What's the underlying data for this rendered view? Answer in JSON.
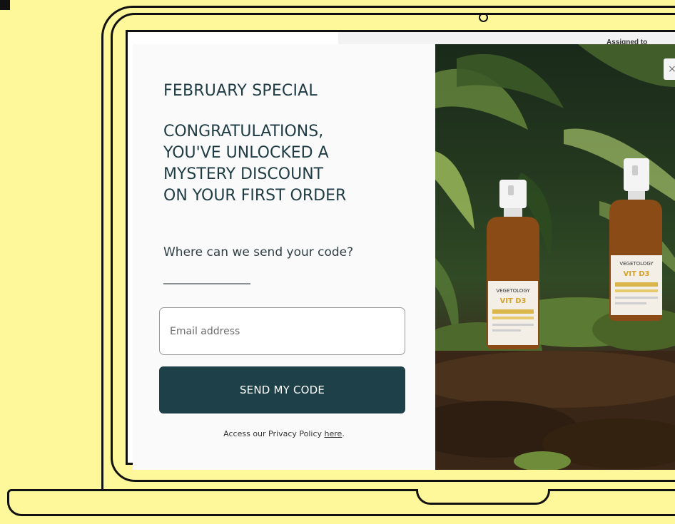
{
  "background_page": {
    "assigned_text": "Assigned to"
  },
  "popup": {
    "eyebrow": "FEBRUARY SPECIAL",
    "headline_lines": [
      "CONGRATULATIONS,",
      "YOU'VE UNLOCKED A",
      "MYSTERY DISCOUNT",
      "ON YOUR FIRST ORDER"
    ],
    "subhead": "Where can we send your code?",
    "email_placeholder": "Email address",
    "email_value": "",
    "submit_label": "SEND MY CODE",
    "privacy_prefix": "Access our Privacy Policy ",
    "privacy_link": "here",
    "privacy_suffix": ".",
    "close_glyph": "×",
    "image_alt": "Two Vegetology VIT D3 spray bottles among ferns and moss",
    "bottle_brand": "VEGETOLOGY",
    "bottle_product": "VIT D3"
  },
  "colors": {
    "background": "#fff89a",
    "accent": "#1e4048",
    "text": "#1f3c45"
  }
}
